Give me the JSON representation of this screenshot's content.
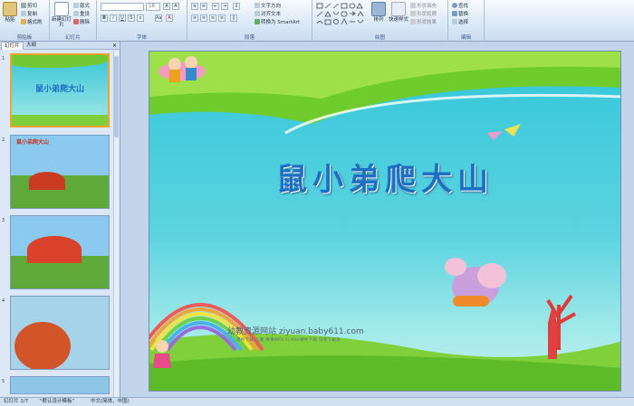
{
  "ribbon": {
    "groups": [
      {
        "label": "剪贴板"
      },
      {
        "label": "幻灯片"
      },
      {
        "label": "字体"
      },
      {
        "label": "段落"
      },
      {
        "label": "绘图"
      },
      {
        "label": "编辑"
      }
    ],
    "paste": "粘贴",
    "cut": "剪切",
    "copy": "复制",
    "format_painter": "格式刷",
    "new_slide": "新建幻灯片",
    "layout": "版式",
    "reset": "重设",
    "delete": "删除",
    "font_size": "18",
    "text_direction": "文字方向",
    "align_text": "对齐文本",
    "smartart": "转换为 SmartArt",
    "arrange": "排列",
    "quick_styles": "快速样式",
    "shape_fill": "形状填充",
    "shape_outline": "形状轮廓",
    "shape_effects": "形状效果",
    "find": "查找",
    "replace": "替换",
    "select": "选择"
  },
  "left_panel": {
    "tabs": [
      "幻灯片",
      "大纲"
    ],
    "slides": [
      {
        "num": "1",
        "title": "鼠小弟爬大山"
      },
      {
        "num": "2",
        "title": "鼠小弟爬大山"
      },
      {
        "num": "3",
        "title": ""
      },
      {
        "num": "4",
        "title": ""
      },
      {
        "num": "5",
        "title": ""
      }
    ]
  },
  "slide": {
    "title": "鼠小弟爬大山",
    "watermark": "幼教资源网站  ziyuan.baby611.com",
    "subline": "课件下载  儿歌  故事MP3  FLASH课件下载  试卷下载等"
  },
  "status": {
    "slide_of": "幻灯片 1/7",
    "theme": "\"默认设计模板\"",
    "language": "中文(简体，中国)"
  },
  "colors": {
    "ribbon": "#dbe8f7",
    "title": "#1d6fc2",
    "slide_bg": "#33c6d9"
  }
}
